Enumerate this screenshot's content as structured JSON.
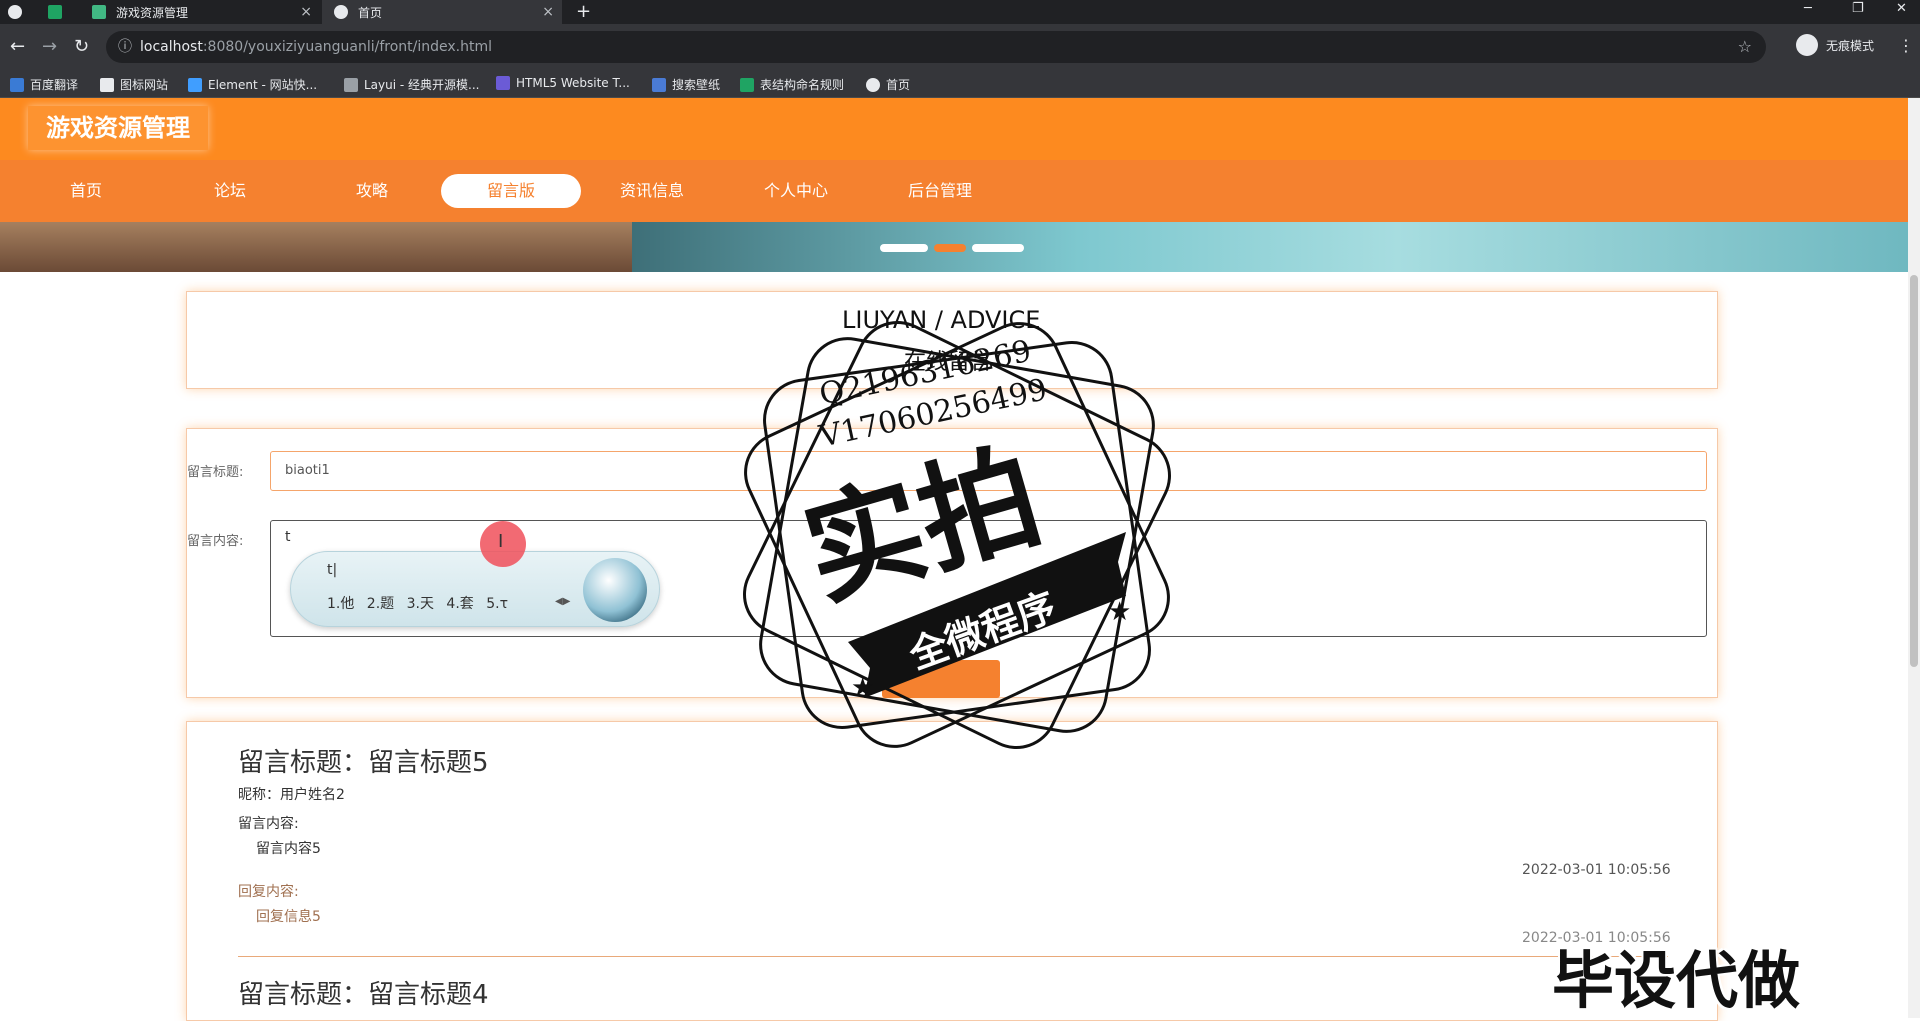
{
  "browser": {
    "tabs": [
      {
        "title": "游戏资源管理"
      },
      {
        "title": "首页"
      }
    ],
    "url_host": "localhost",
    "url_path": ":8080/youxiziyuanguanli/front/index.html",
    "profile_label": "无痕模式",
    "bookmarks": [
      "百度翻译",
      "图标网站",
      "Element - 网站快...",
      "Layui - 经典开源模...",
      "HTML5 Website T...",
      "搜索壁纸",
      "表结构命名规则",
      "首页"
    ]
  },
  "site": {
    "logo": "游戏资源管理",
    "nav": [
      {
        "label": "首页"
      },
      {
        "label": "论坛"
      },
      {
        "label": "攻略"
      },
      {
        "label": "留言版"
      },
      {
        "label": "资讯信息"
      },
      {
        "label": "个人中心"
      },
      {
        "label": "后台管理"
      }
    ],
    "active_nav": "留言版",
    "accent_color": "#f5812f"
  },
  "form": {
    "title_label": "留言标题:",
    "title_value": "biaoti1",
    "content_label": "留言内容:",
    "content_value": "t"
  },
  "ime": {
    "composition": "t|",
    "candidates": "1.他 2.题 3.天 4.套 5.τ"
  },
  "messages": [
    {
      "title": "留言标题：留言标题5",
      "nickname": "昵称：用户姓名2",
      "content_label": "留言内容:",
      "content": "留言内容5",
      "time": "2022-03-01 10:05:56",
      "reply_label": "回复内容:",
      "reply": "回复信息5",
      "reply_time": "2022-03-01 10:05:56"
    },
    {
      "title": "留言标题：留言标题4"
    }
  ],
  "watermark": {
    "line1": "LIUYAN / ADVICE",
    "line2": "在线留言",
    "qq": "Q2196316269",
    "vx": "V17060256499",
    "big": "实拍",
    "ribbon": "全微程序",
    "corner": "毕设代做"
  }
}
